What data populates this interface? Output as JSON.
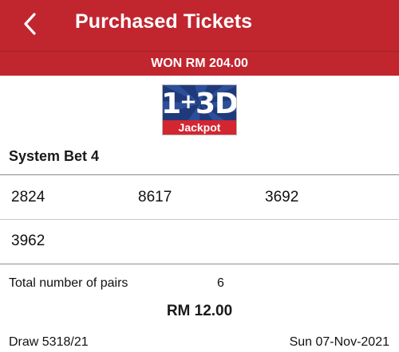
{
  "header": {
    "title": "Purchased Tickets",
    "back_icon": "chevron-left-icon"
  },
  "banner": {
    "won_text": "WON RM 204.00"
  },
  "logo": {
    "main": "1+3D",
    "sub": "Jackpot"
  },
  "bet": {
    "type": "System Bet 4",
    "numbers": [
      "2824",
      "8617",
      "3692",
      "3962"
    ],
    "pairs_label": "Total number of pairs",
    "pairs_value": "6",
    "total": "RM 12.00"
  },
  "draw": {
    "number": "Draw 5318/21",
    "date": "Sun 07-Nov-2021"
  },
  "colors": {
    "header_red": "#c1262f",
    "logo_blue": "#1f3a7a",
    "logo_red": "#d32630"
  }
}
